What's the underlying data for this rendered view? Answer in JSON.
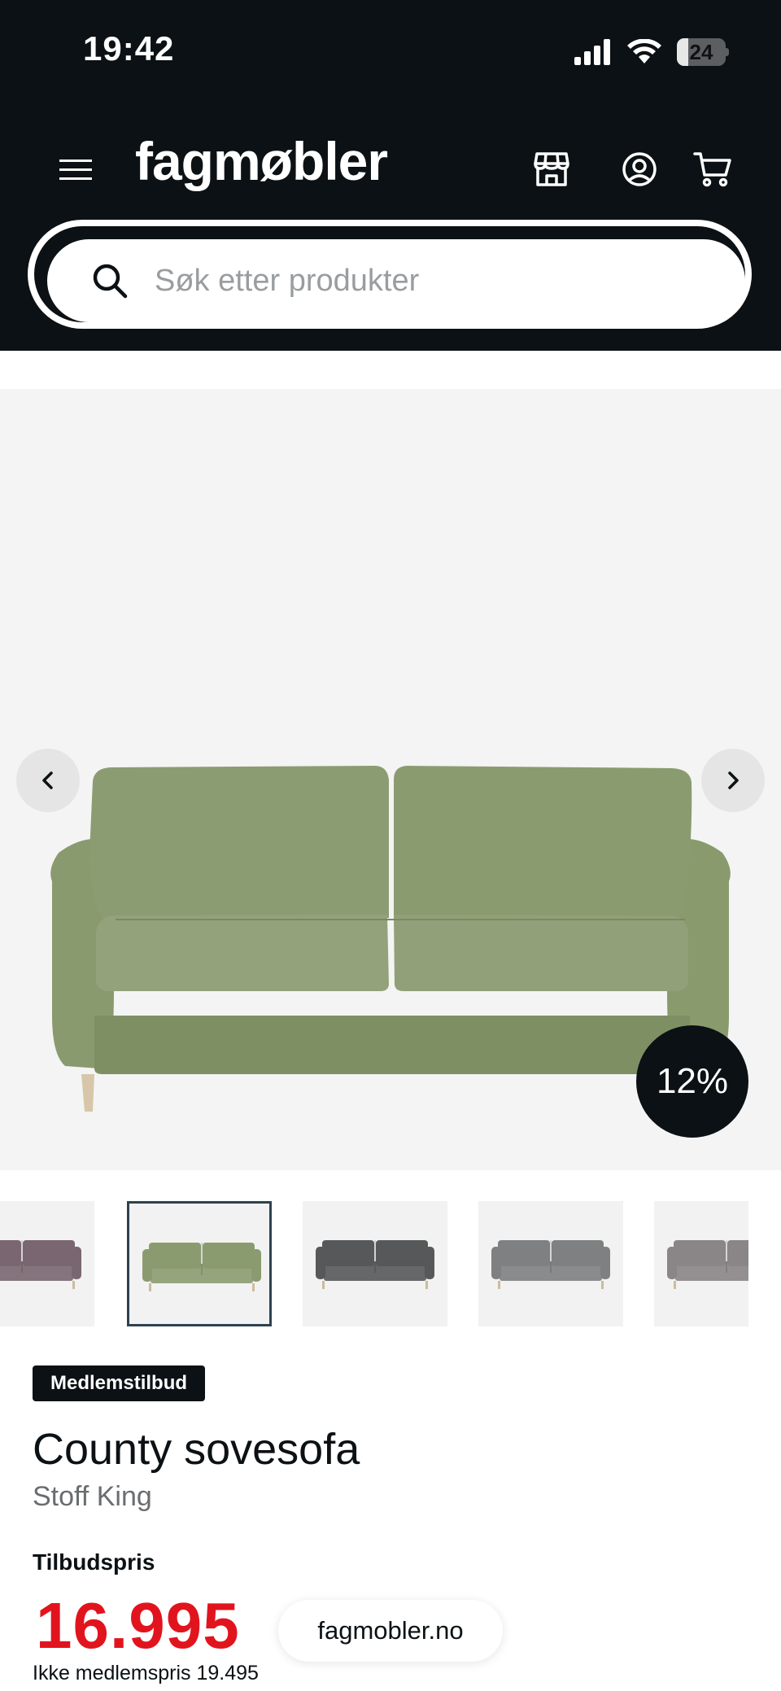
{
  "status_bar": {
    "time": "19:42",
    "battery": "24",
    "battery_level": 0.24
  },
  "header": {
    "logo": "fagmøbler",
    "icons": [
      "menu-icon",
      "store-icon",
      "account-icon",
      "cart-icon"
    ]
  },
  "search": {
    "placeholder": "Søk etter produkter",
    "value": ""
  },
  "gallery": {
    "discount": "12%",
    "thumbnails": [
      {
        "color": "#7a6670",
        "selected": false
      },
      {
        "color": "#8b9b70",
        "selected": true
      },
      {
        "color": "#565859",
        "selected": false
      },
      {
        "color": "#7e8082",
        "selected": false
      },
      {
        "color": "#8a8587",
        "selected": false
      }
    ]
  },
  "product": {
    "badge": "Medlemstilbud",
    "title": "County sovesofa",
    "subtitle": "Stoff King",
    "price_label": "Tilbudspris",
    "price": "16.995",
    "non_member_price": "Ikke medlemspris 19.495"
  },
  "browser": {
    "domain": "fagmobler.no"
  },
  "colors": {
    "header_bg": "#0b1114",
    "price_red": "#e1141e",
    "sofa_green": "#8b9b70"
  }
}
